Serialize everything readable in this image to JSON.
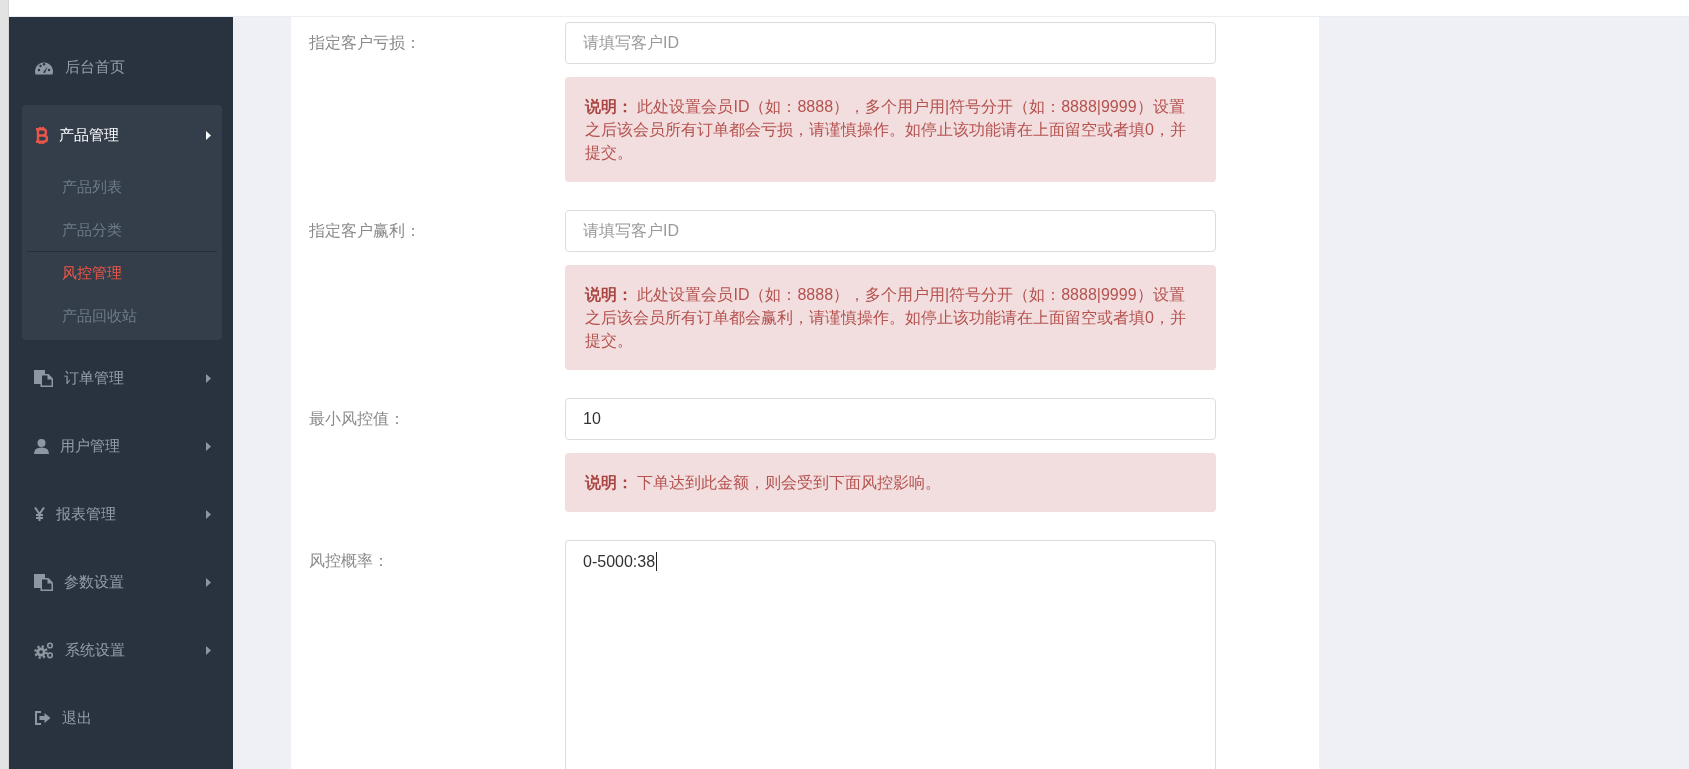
{
  "sidebar": {
    "items": [
      {
        "label": "后台首页",
        "kind": "link"
      },
      {
        "label": "产品管理",
        "kind": "group",
        "expanded": true,
        "children": [
          {
            "label": "产品列表",
            "selected": false
          },
          {
            "label": "产品分类",
            "selected": false
          },
          {
            "label": "风控管理",
            "selected": true
          },
          {
            "label": "产品回收站",
            "selected": false
          }
        ]
      },
      {
        "label": "订单管理",
        "kind": "group",
        "expanded": false
      },
      {
        "label": "用户管理",
        "kind": "group",
        "expanded": false
      },
      {
        "label": "报表管理",
        "kind": "group",
        "expanded": false
      },
      {
        "label": "参数设置",
        "kind": "group",
        "expanded": false
      },
      {
        "label": "系统设置",
        "kind": "group",
        "expanded": false
      },
      {
        "label": "退出",
        "kind": "link"
      }
    ]
  },
  "form": {
    "fields": [
      {
        "label": "指定客户亏损：",
        "kind": "input",
        "placeholder": "请填写客户ID",
        "note": "**说明：** 此处设置会员ID（如：8888），多个用户用|符号分开（如：8888|9999）设置之后该会员所有订单都会亏损，请谨慎操作。如停止该功能请在上面留空或者填0，并提交。"
      },
      {
        "label": "指定客户赢利：",
        "kind": "input",
        "placeholder": "请填写客户ID",
        "note": "**说明：** 此处设置会员ID（如：8888），多个用户用|符号分开（如：8888|9999）设置之后该会员所有订单都会赢利，请谨慎操作。如停止该功能请在上面留空或者填0，并提交。"
      },
      {
        "label": "最小风控值：",
        "kind": "input",
        "value": "10",
        "note": "**说明：** 下单达到此金额，则会受到下面风控影响。"
      },
      {
        "label": "风控概率：",
        "kind": "textarea",
        "value": "0-5000:38",
        "focused": true
      }
    ]
  }
}
